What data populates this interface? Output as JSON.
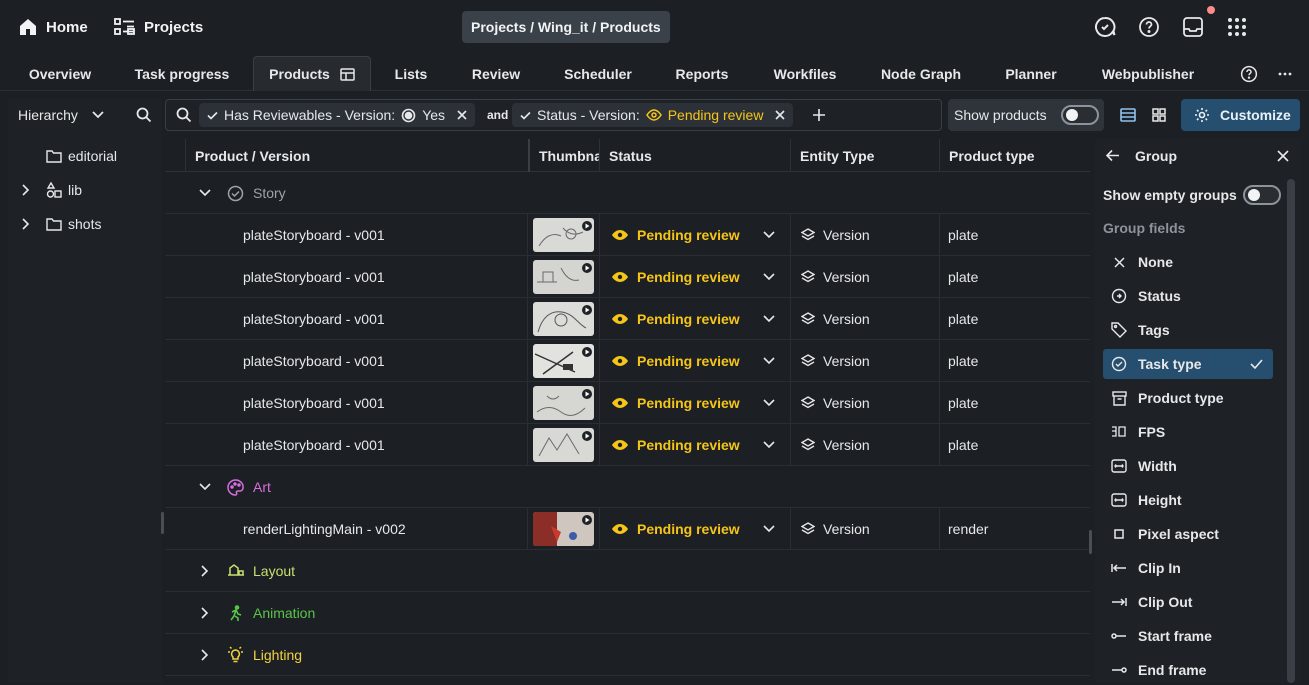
{
  "topbar": {
    "home_label": "Home",
    "projects_label": "Projects",
    "breadcrumb": "Projects / Wing_it / Products"
  },
  "tabs": [
    {
      "label": "Overview"
    },
    {
      "label": "Task progress"
    },
    {
      "label": "Products",
      "active": true
    },
    {
      "label": "Lists"
    },
    {
      "label": "Review"
    },
    {
      "label": "Scheduler"
    },
    {
      "label": "Reports"
    },
    {
      "label": "Workfiles"
    },
    {
      "label": "Node Graph"
    },
    {
      "label": "Planner"
    },
    {
      "label": "Webpublisher"
    }
  ],
  "sidebar": {
    "mode_label": "Hierarchy",
    "items": [
      {
        "label": "editorial",
        "icon": "folder-icon"
      },
      {
        "label": "lib",
        "icon": "shapes-icon"
      },
      {
        "label": "shots",
        "icon": "folder-icon"
      }
    ]
  },
  "filters": {
    "chip1_field": "Has Reviewables - Version:",
    "chip1_value": "Yes",
    "connector": "and",
    "chip2_field": "Status - Version:",
    "chip2_value": "Pending review"
  },
  "toolbar": {
    "show_products_label": "Show products",
    "customize_label": "Customize"
  },
  "table": {
    "columns": [
      "Product / Version",
      "Thumbnail",
      "Status",
      "Entity Type",
      "Product type"
    ],
    "groups": [
      {
        "name": "Story",
        "color": "#9ea3a8",
        "expanded": true
      },
      {
        "name": "Art",
        "color": "#d86ee0",
        "expanded": true
      },
      {
        "name": "Layout",
        "color": "#c8e06e",
        "expanded": false
      },
      {
        "name": "Animation",
        "color": "#59c64a",
        "expanded": false
      },
      {
        "name": "Lighting",
        "color": "#f2d341",
        "expanded": false
      }
    ],
    "rows": [
      {
        "name": "plateStoryboard - v001",
        "status": "Pending review",
        "entity": "Version",
        "product_type": "plate"
      },
      {
        "name": "plateStoryboard - v001",
        "status": "Pending review",
        "entity": "Version",
        "product_type": "plate"
      },
      {
        "name": "plateStoryboard - v001",
        "status": "Pending review",
        "entity": "Version",
        "product_type": "plate"
      },
      {
        "name": "plateStoryboard - v001",
        "status": "Pending review",
        "entity": "Version",
        "product_type": "plate"
      },
      {
        "name": "plateStoryboard - v001",
        "status": "Pending review",
        "entity": "Version",
        "product_type": "plate"
      },
      {
        "name": "plateStoryboard - v001",
        "status": "Pending review",
        "entity": "Version",
        "product_type": "plate"
      },
      {
        "name": "renderLightingMain - v002",
        "status": "Pending review",
        "entity": "Version",
        "product_type": "render"
      }
    ]
  },
  "group_panel": {
    "title": "Group",
    "show_empty_label": "Show empty groups",
    "fields_label": "Group fields",
    "fields": [
      {
        "label": "None",
        "icon": "x-icon"
      },
      {
        "label": "Status",
        "icon": "status-icon"
      },
      {
        "label": "Tags",
        "icon": "tag-icon"
      },
      {
        "label": "Task type",
        "icon": "check-circle-icon",
        "selected": true
      },
      {
        "label": "Product type",
        "icon": "archive-icon"
      },
      {
        "label": "FPS",
        "icon": "fps-icon"
      },
      {
        "label": "Width",
        "icon": "dimension-icon"
      },
      {
        "label": "Height",
        "icon": "dimension-icon"
      },
      {
        "label": "Pixel aspect",
        "icon": "square-icon"
      },
      {
        "label": "Clip In",
        "icon": "clip-in-icon"
      },
      {
        "label": "Clip Out",
        "icon": "clip-out-icon"
      },
      {
        "label": "Start frame",
        "icon": "start-frame-icon"
      },
      {
        "label": "End frame",
        "icon": "end-frame-icon"
      }
    ]
  }
}
